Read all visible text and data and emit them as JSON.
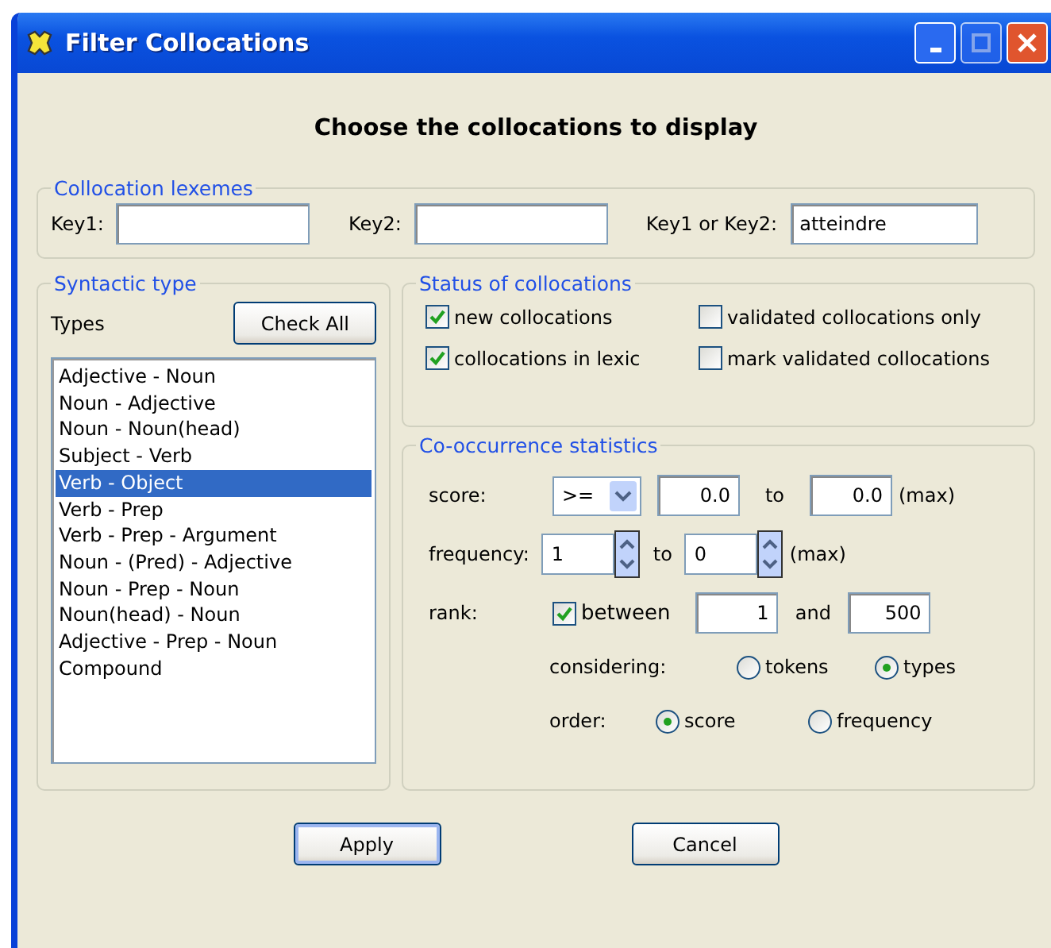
{
  "window": {
    "title": "Filter Collocations"
  },
  "heading": "Choose the collocations to display",
  "lexemes": {
    "title": "Collocation lexemes",
    "fields": [
      {
        "label": "Key1:"
      },
      {
        "label": "Key2:"
      },
      {
        "label": "Key1 or Key2:",
        "value": "atteindre"
      }
    ]
  },
  "syntactic_type": {
    "title": "Syntactic type",
    "label": "Types",
    "button": "Check All",
    "items": [
      {
        "label": "Adjective - Noun",
        "selected": false
      },
      {
        "label": "Noun - Adjective",
        "selected": false
      },
      {
        "label": "Noun - Noun(head)",
        "selected": false
      },
      {
        "label": "Subject - Verb",
        "selected": false
      },
      {
        "label": "Verb - Object",
        "selected": true
      },
      {
        "label": "Verb - Prep",
        "selected": false
      },
      {
        "label": "Verb - Prep - Argument",
        "selected": false
      },
      {
        "label": "Noun - (Pred) - Adjective",
        "selected": false
      },
      {
        "label": "Noun - Prep - Noun",
        "selected": false
      },
      {
        "label": "Noun(head) - Noun",
        "selected": false
      },
      {
        "label": "Adjective - Prep - Noun",
        "selected": false
      },
      {
        "label": "Compound",
        "selected": false
      }
    ]
  },
  "status": {
    "title": "Status of collocations",
    "options": [
      {
        "label": "new collocations",
        "checked": true
      },
      {
        "label": "validated collocations only",
        "checked": false
      },
      {
        "label": "collocations in lexic",
        "checked": true
      },
      {
        "label": "mark validated collocations",
        "checked": false
      }
    ]
  },
  "statistics": {
    "title": "Co-occurrence statistics",
    "score": {
      "label": "score:",
      "operator": ">=",
      "from": "0.0",
      "to_label": "to",
      "to": "0.0",
      "max": "(max)"
    },
    "frequency": {
      "label": "frequency:",
      "from": "1",
      "to_label": "to",
      "to": "0",
      "max": "(max)"
    },
    "rank": {
      "label": "rank:",
      "checkbox": {
        "label": "between",
        "checked": true
      },
      "from": "1",
      "and_label": "and",
      "to": "500"
    },
    "considering": {
      "label": "considering:",
      "options": [
        {
          "label": "tokens",
          "selected": false
        },
        {
          "label": "types",
          "selected": true
        }
      ]
    },
    "order": {
      "label": "order:",
      "options": [
        {
          "label": "score",
          "selected": true
        },
        {
          "label": "frequency",
          "selected": false
        }
      ]
    }
  },
  "buttons": [
    "Apply",
    "Cancel"
  ]
}
